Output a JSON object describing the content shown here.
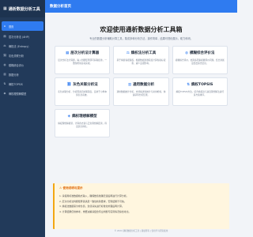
{
  "app": {
    "title": "通析数据分析工具",
    "icon": "chart-icon"
  },
  "topbar": {
    "title": "数据分析首页"
  },
  "sidebar": {
    "items": [
      {
        "label": "首页",
        "icon": "home-icon",
        "active": true
      },
      {
        "label": "层次分析法 (AHP)",
        "icon": "layers-icon"
      },
      {
        "label": "熵权法 (Entropy)",
        "icon": "scale-icon"
      },
      {
        "label": "灰色关联分析",
        "icon": "link-icon"
      },
      {
        "label": "模糊综合评价",
        "icon": "blur-icon"
      },
      {
        "label": "数据分析",
        "icon": "analysis-icon"
      },
      {
        "label": "熵权TOPSIS",
        "icon": "sort-icon"
      },
      {
        "label": "熵权理想解模型",
        "icon": "model-icon"
      }
    ]
  },
  "hero": {
    "title": "欢迎使用通析数据分析工具箱",
    "subtitle": "专业的数据分析辅助计算工具，集成多种分析方法，操作简单，结果可视化展示，助力科研。"
  },
  "cards": [
    {
      "title": "层次分析法计算器",
      "icon": "calc-icon",
      "desc": "层次分析法计算器，输入判断矩阵即可获取权重，一致性检验自动完成。"
    },
    {
      "title": "熵权法分析工具",
      "icon": "scale-icon",
      "desc": "基于熵值客观赋权，根据数据离散程度计算各指标权重，减少主观影响。"
    },
    {
      "title": "模糊综合评价法",
      "icon": "fuzzy-icon",
      "desc": "模糊综合评价，处理多因素模糊评价问题，结合隶属度给出综合结论。"
    },
    {
      "title": "灰色关联分析法",
      "icon": "grey-icon",
      "desc": "灰色关联分析，分析因素间关联程度，适用于小样本贫信息系统。"
    },
    {
      "title": "通用数据分析",
      "icon": "analysis-icon",
      "desc": "通用数据统计分析，支持描述性统计与常用检验，快速获得分析结果。"
    },
    {
      "title": "熵权TOPSIS",
      "icon": "topsis-icon",
      "desc": "熵权TOPSIS方法，结合熵权法与逼近理想解法进行多方案排序。"
    },
    {
      "title": "熵权理想解模型",
      "icon": "ideal-icon",
      "desc": "熵权理想解模型，计算各方案与正负理想解距离，得出优劣排名。"
    }
  ],
  "notice": {
    "title": "⚠ 使用说明与提示",
    "items": [
      "1. 请使用标准数据格式输入，确保数值准确无误后再进行计算分析。",
      "2. 层次分析法判断矩阵需满足一致性检验要求，否则结果不可信。",
      "3. 熵权法数据需为非负值，负值请先进行标准化处理后再计算。",
      "4. 计算结果仅供参考，重要决策请结合专业判断与实际情况综合考虑。"
    ]
  },
  "footer": {
    "text": "© 2024 通析数据分析工具 | 版权所有 | 仅供学习研究使用"
  },
  "colors": {
    "primary": "#2f7bf0",
    "sidebar": "#223a5a",
    "warning": "#f3a712"
  }
}
